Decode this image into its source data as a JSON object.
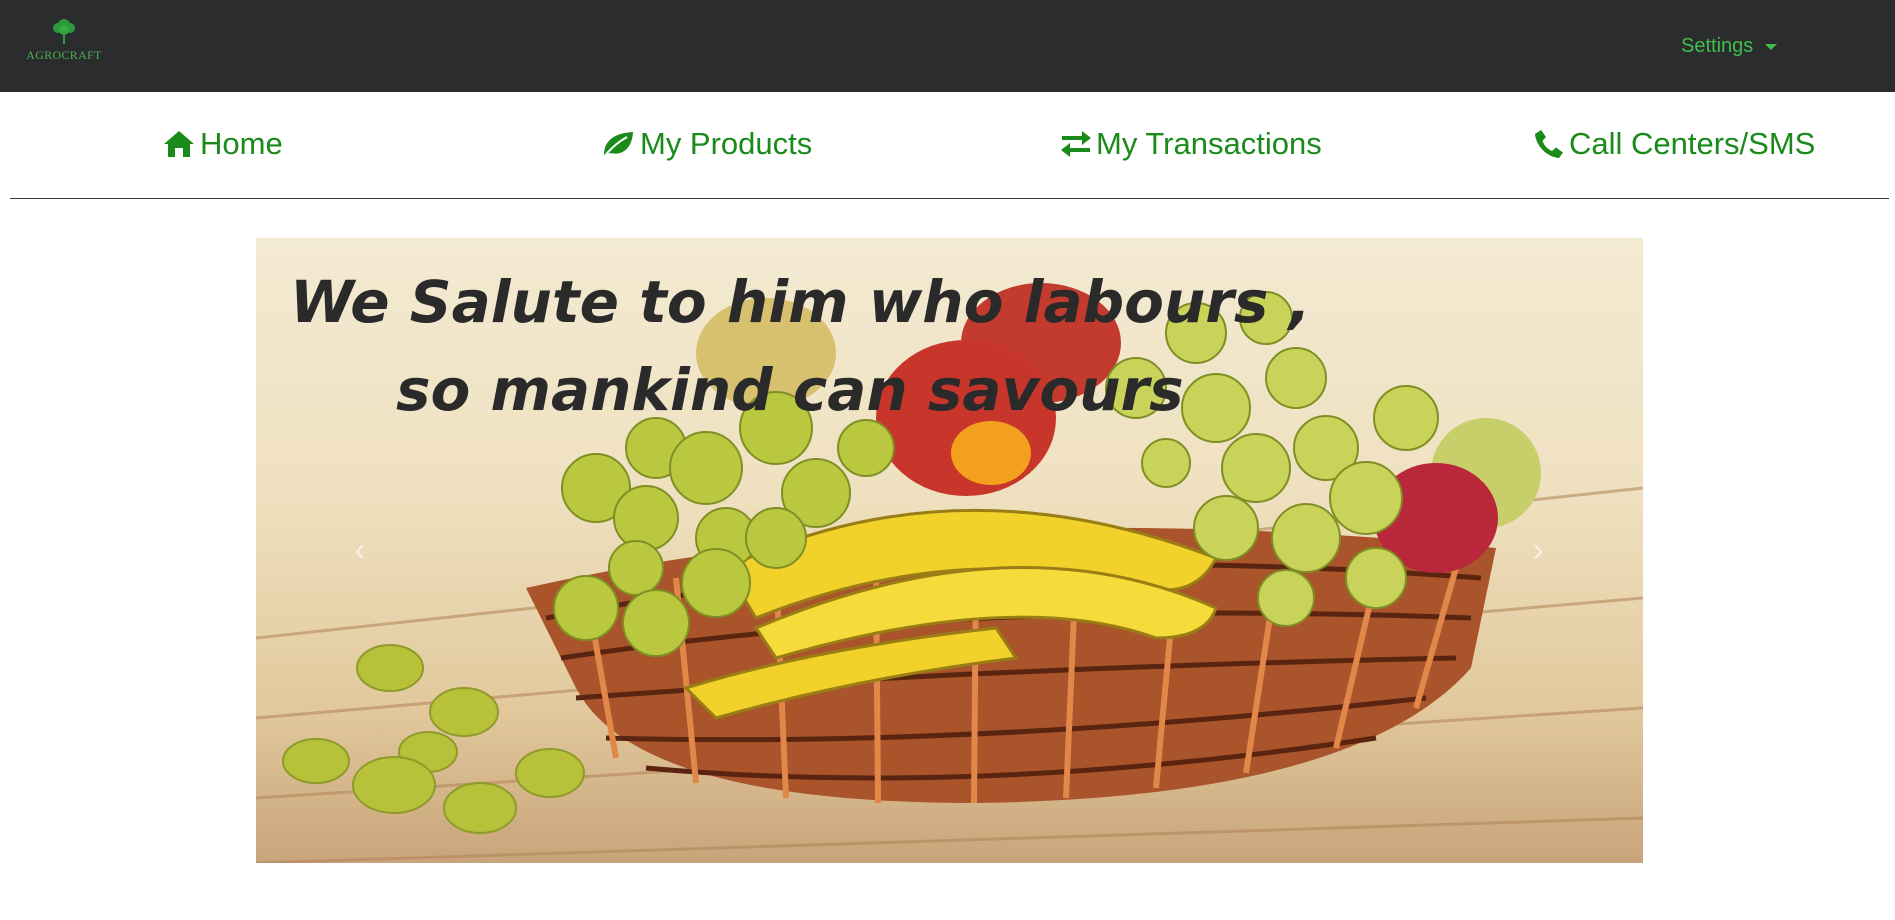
{
  "brand": {
    "logo_text": "AGROCRAFT"
  },
  "header": {
    "settings_label": "Settings"
  },
  "nav": {
    "items": [
      {
        "label": "Home",
        "icon": "home-icon"
      },
      {
        "label": "My Products",
        "icon": "leaf-icon"
      },
      {
        "label": "My Transactions",
        "icon": "exchange-icon"
      },
      {
        "label": "Call Centers/SMS",
        "icon": "phone-icon"
      }
    ]
  },
  "hero": {
    "line1": "We Salute to him who labours ,",
    "line2": "so mankind can savours",
    "prev_icon": "chevron-left-icon",
    "next_icon": "chevron-right-icon"
  },
  "colors": {
    "topbar": "#2b2c2e",
    "accent": "#3fbf4a",
    "nav_text": "#1a8a1a"
  }
}
